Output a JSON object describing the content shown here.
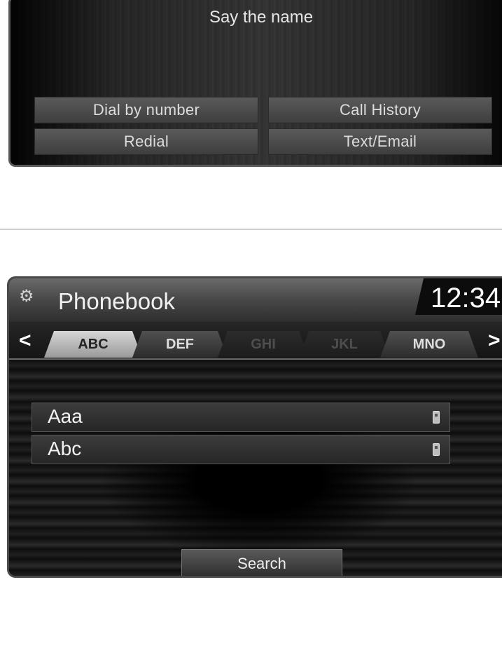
{
  "voice_screen": {
    "prompt": "Say the name",
    "buttons": [
      "Dial by number",
      "Call History",
      "Redial",
      "Text/Email"
    ]
  },
  "phonebook": {
    "title": "Phonebook",
    "clock": "12:34",
    "settings_icon": "gear-icon",
    "nav": {
      "prev": "<",
      "next": ">"
    },
    "tabs": [
      {
        "label": "ABC",
        "state": "active"
      },
      {
        "label": "DEF",
        "state": "enabled"
      },
      {
        "label": "GHI",
        "state": "disabled"
      },
      {
        "label": "JKL",
        "state": "disabled"
      },
      {
        "label": "MNO",
        "state": "enabled"
      }
    ],
    "contacts": [
      {
        "name": "Aaa",
        "icon": "mobile-phone-icon"
      },
      {
        "name": "Abc",
        "icon": "mobile-phone-icon"
      }
    ],
    "search_label": "Search"
  }
}
